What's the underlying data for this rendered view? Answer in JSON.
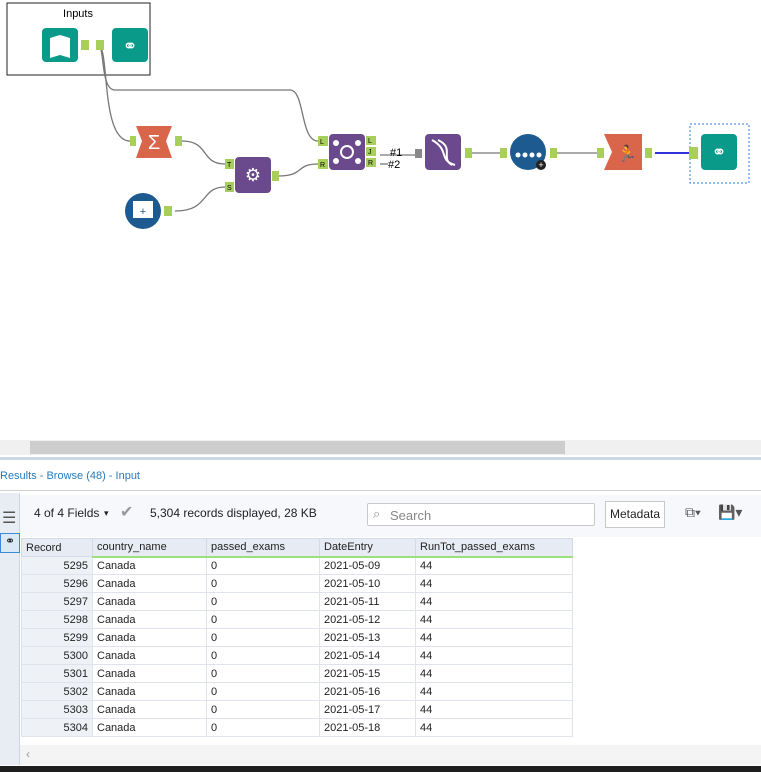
{
  "canvas": {
    "container_label": "Inputs",
    "join_labels": {
      "left_in": "L",
      "right_in": "R",
      "left_out": "L",
      "join_out": "J",
      "right_out": "R"
    },
    "append_labels": {
      "target": "T",
      "source": "S"
    },
    "wire_labels": [
      "#1",
      "#2"
    ]
  },
  "results": {
    "title": "Results - Browse (48) - Input"
  },
  "toolbar": {
    "fields": "4 of 4 Fields",
    "records": "5,304 records displayed, 28 KB",
    "search_placeholder": "Search",
    "metadata": "Metadata"
  },
  "table": {
    "columns": [
      "Record",
      "country_name",
      "passed_exams",
      "DateEntry",
      "RunTot_passed_exams"
    ],
    "rows": [
      [
        "5295",
        "Canada",
        "0",
        "2021-05-09",
        "44"
      ],
      [
        "5296",
        "Canada",
        "0",
        "2021-05-10",
        "44"
      ],
      [
        "5297",
        "Canada",
        "0",
        "2021-05-11",
        "44"
      ],
      [
        "5298",
        "Canada",
        "0",
        "2021-05-12",
        "44"
      ],
      [
        "5299",
        "Canada",
        "0",
        "2021-05-13",
        "44"
      ],
      [
        "5300",
        "Canada",
        "0",
        "2021-05-14",
        "44"
      ],
      [
        "5301",
        "Canada",
        "0",
        "2021-05-15",
        "44"
      ],
      [
        "5302",
        "Canada",
        "0",
        "2021-05-16",
        "44"
      ],
      [
        "5303",
        "Canada",
        "0",
        "2021-05-17",
        "44"
      ],
      [
        "5304",
        "Canada",
        "0",
        "2021-05-18",
        "44"
      ]
    ]
  },
  "colors": {
    "teal": "#0a9a8a",
    "orange": "#d9654b",
    "purple": "#6a4a8c",
    "blue": "#1d5a8f",
    "anchor": "#a8cf5a"
  }
}
